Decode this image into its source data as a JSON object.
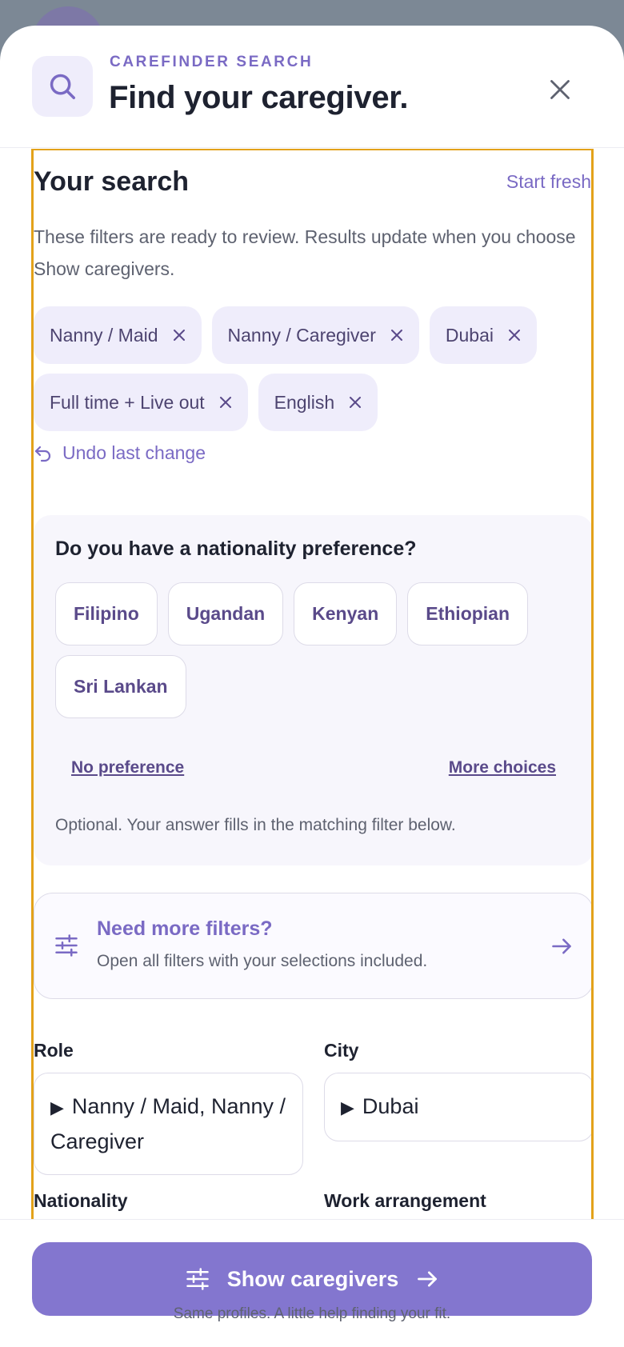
{
  "header": {
    "eyebrow": "CAREFINDER SEARCH",
    "title": "Find your caregiver."
  },
  "search": {
    "title": "Your search",
    "start_fresh": "Start fresh",
    "description": "These filters are ready to review. Results update when you choose Show caregivers.",
    "chips": [
      "Nanny / Maid",
      "Nanny / Caregiver",
      "Dubai",
      "Full time + Live out",
      "English"
    ],
    "undo": "Undo last change"
  },
  "nationality": {
    "question": "Do you have a nationality preference?",
    "options": [
      "Filipino",
      "Ugandan",
      "Kenyan",
      "Ethiopian",
      "Sri Lankan"
    ],
    "no_preference": "No preference",
    "more_choices": "More choices",
    "note": "Optional. Your answer fills in the matching filter below."
  },
  "more_filters": {
    "title": "Need more filters?",
    "subtitle": "Open all filters with your selections included."
  },
  "fields": {
    "role_label": "Role",
    "role_value": "Nanny / Maid, Nanny / Caregiver",
    "city_label": "City",
    "city_value": "Dubai",
    "nationality_label": "Nationality",
    "work_label": "Work arrangement"
  },
  "footer": {
    "cta": "Show caregivers",
    "note": "Same profiles. A little help finding your fit."
  },
  "colors": {
    "accent": "#7a6ac4",
    "cta_bg": "#8376cf",
    "chip_bg": "#efedfb",
    "focus_outline": "#e3a21a"
  }
}
